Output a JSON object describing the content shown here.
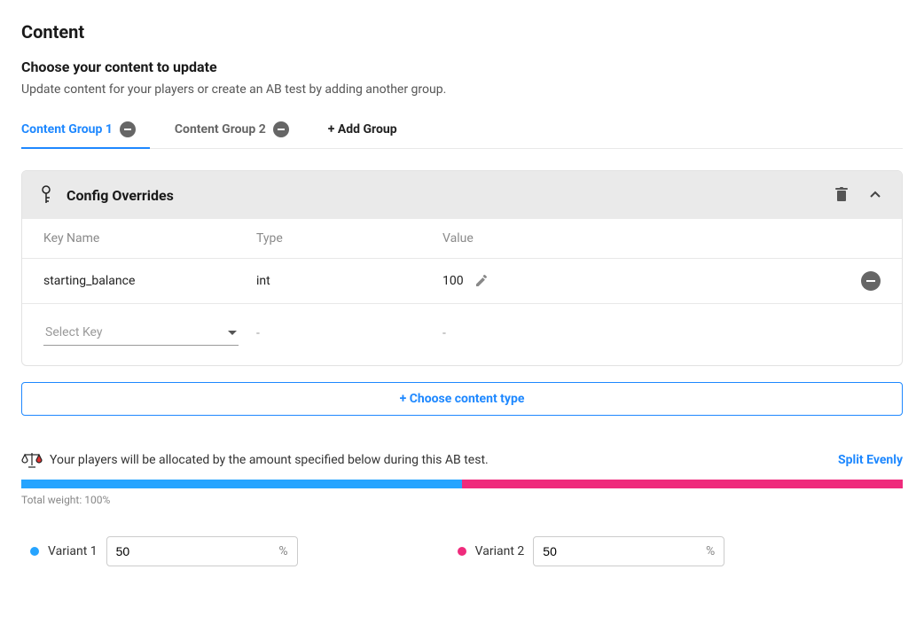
{
  "page": {
    "title": "Content",
    "section_title": "Choose your content to update",
    "section_sub": "Update content for your players or create an AB test by adding another group."
  },
  "tabs": {
    "items": [
      {
        "label": "Content Group 1",
        "active": true
      },
      {
        "label": "Content Group 2",
        "active": false
      }
    ],
    "add_label": "+ Add Group"
  },
  "panel": {
    "title": "Config Overrides",
    "columns": {
      "key": "Key Name",
      "type": "Type",
      "value": "Value"
    },
    "rows": [
      {
        "key": "starting_balance",
        "type": "int",
        "value": "100"
      }
    ],
    "select_placeholder": "Select Key",
    "dash": "-"
  },
  "choose_button": "+ Choose content type",
  "allocation": {
    "text": "Your players will be allocated by the amount specified below during this AB test.",
    "split_link": "Split Evenly",
    "total_weight": "Total weight: 100%",
    "variants": [
      {
        "label": "Variant 1",
        "value": "50",
        "color": "blue",
        "percent": 50
      },
      {
        "label": "Variant 2",
        "value": "50",
        "color": "pink",
        "percent": 50
      }
    ],
    "pct_suffix": "%"
  }
}
